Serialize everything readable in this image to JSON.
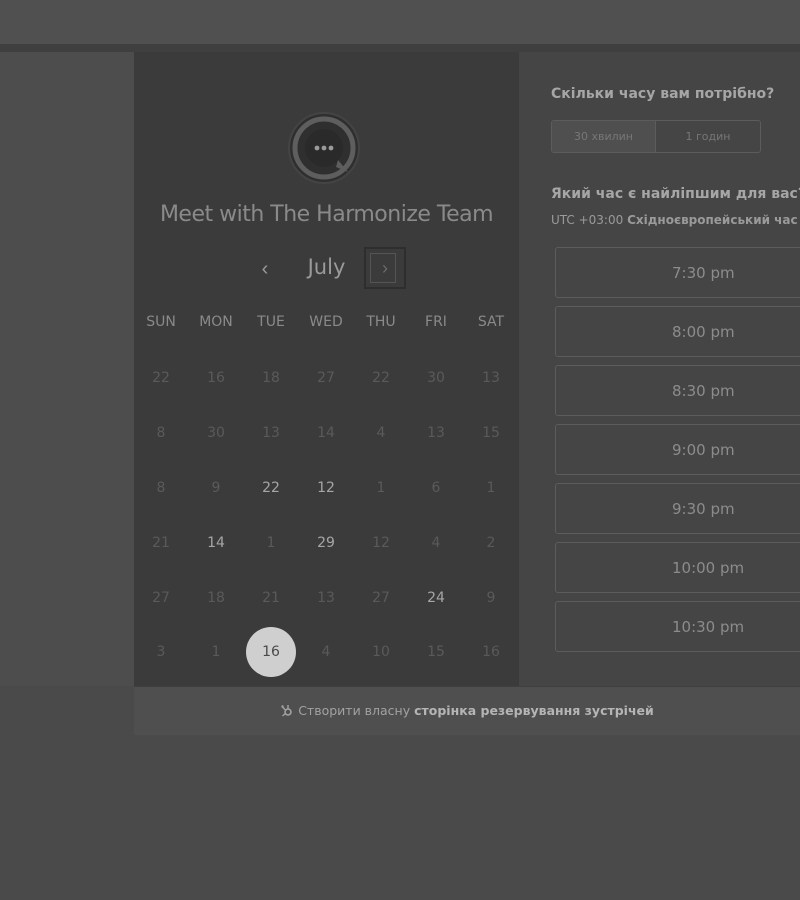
{
  "calendar": {
    "title": "Meet with The Harmonize Team",
    "month": "July",
    "prev_glyph": "‹",
    "next_glyph": "›",
    "weekdays": [
      "SUN",
      "MON",
      "TUE",
      "WED",
      "THU",
      "FRI",
      "SAT"
    ],
    "weeks": [
      [
        {
          "d": "22",
          "s": "disabled"
        },
        {
          "d": "16",
          "s": "disabled"
        },
        {
          "d": "18",
          "s": "disabled"
        },
        {
          "d": "27",
          "s": "disabled"
        },
        {
          "d": "22",
          "s": "disabled"
        },
        {
          "d": "30",
          "s": "disabled"
        },
        {
          "d": "13",
          "s": "disabled"
        }
      ],
      [
        {
          "d": "8",
          "s": "disabled"
        },
        {
          "d": "30",
          "s": "disabled"
        },
        {
          "d": "13",
          "s": "disabled"
        },
        {
          "d": "14",
          "s": "disabled"
        },
        {
          "d": "4",
          "s": "disabled"
        },
        {
          "d": "13",
          "s": "disabled"
        },
        {
          "d": "15",
          "s": "disabled"
        }
      ],
      [
        {
          "d": "8",
          "s": "disabled"
        },
        {
          "d": "9",
          "s": "disabled"
        },
        {
          "d": "22",
          "s": "available"
        },
        {
          "d": "12",
          "s": "available"
        },
        {
          "d": "1",
          "s": "disabled"
        },
        {
          "d": "6",
          "s": "disabled"
        },
        {
          "d": "1",
          "s": "disabled"
        }
      ],
      [
        {
          "d": "21",
          "s": "disabled"
        },
        {
          "d": "14",
          "s": "available"
        },
        {
          "d": "1",
          "s": "disabled"
        },
        {
          "d": "29",
          "s": "available"
        },
        {
          "d": "12",
          "s": "disabled"
        },
        {
          "d": "4",
          "s": "disabled"
        },
        {
          "d": "2",
          "s": "disabled"
        }
      ],
      [
        {
          "d": "27",
          "s": "disabled"
        },
        {
          "d": "18",
          "s": "disabled"
        },
        {
          "d": "21",
          "s": "disabled"
        },
        {
          "d": "13",
          "s": "disabled"
        },
        {
          "d": "27",
          "s": "disabled"
        },
        {
          "d": "24",
          "s": "available"
        },
        {
          "d": "9",
          "s": "disabled"
        }
      ],
      [
        {
          "d": "3",
          "s": "disabled"
        },
        {
          "d": "1",
          "s": "disabled"
        },
        {
          "d": "16",
          "s": "selected"
        },
        {
          "d": "4",
          "s": "disabled"
        },
        {
          "d": "10",
          "s": "disabled"
        },
        {
          "d": "15",
          "s": "disabled"
        },
        {
          "d": "16",
          "s": "disabled"
        }
      ]
    ]
  },
  "booking": {
    "duration_question": "Скільки часу вам потрібно?",
    "durations": [
      "30 хвилин",
      "1 годин"
    ],
    "selected_duration": "30 хвилин",
    "time_question": "Який час є найліпшим для вас?",
    "timezone_offset": "UTC +03:00",
    "timezone_name": "Східноєвропейський час",
    "slots": [
      "7:30 pm",
      "8:00 pm",
      "8:30 pm",
      "9:00 pm",
      "9:30 pm",
      "10:00 pm",
      "10:30 pm"
    ]
  },
  "footer": {
    "prefix": "Створити власну",
    "link": "сторінка резервування зустрічей"
  },
  "icons": {
    "logo": "chat-bubble-logo-icon",
    "footer": "hubspot-sprocket-icon"
  },
  "colors": {
    "background": "#4a4a4a",
    "calendar_panel": "#3b3b3b",
    "selected_day": "#cfcfcf"
  }
}
